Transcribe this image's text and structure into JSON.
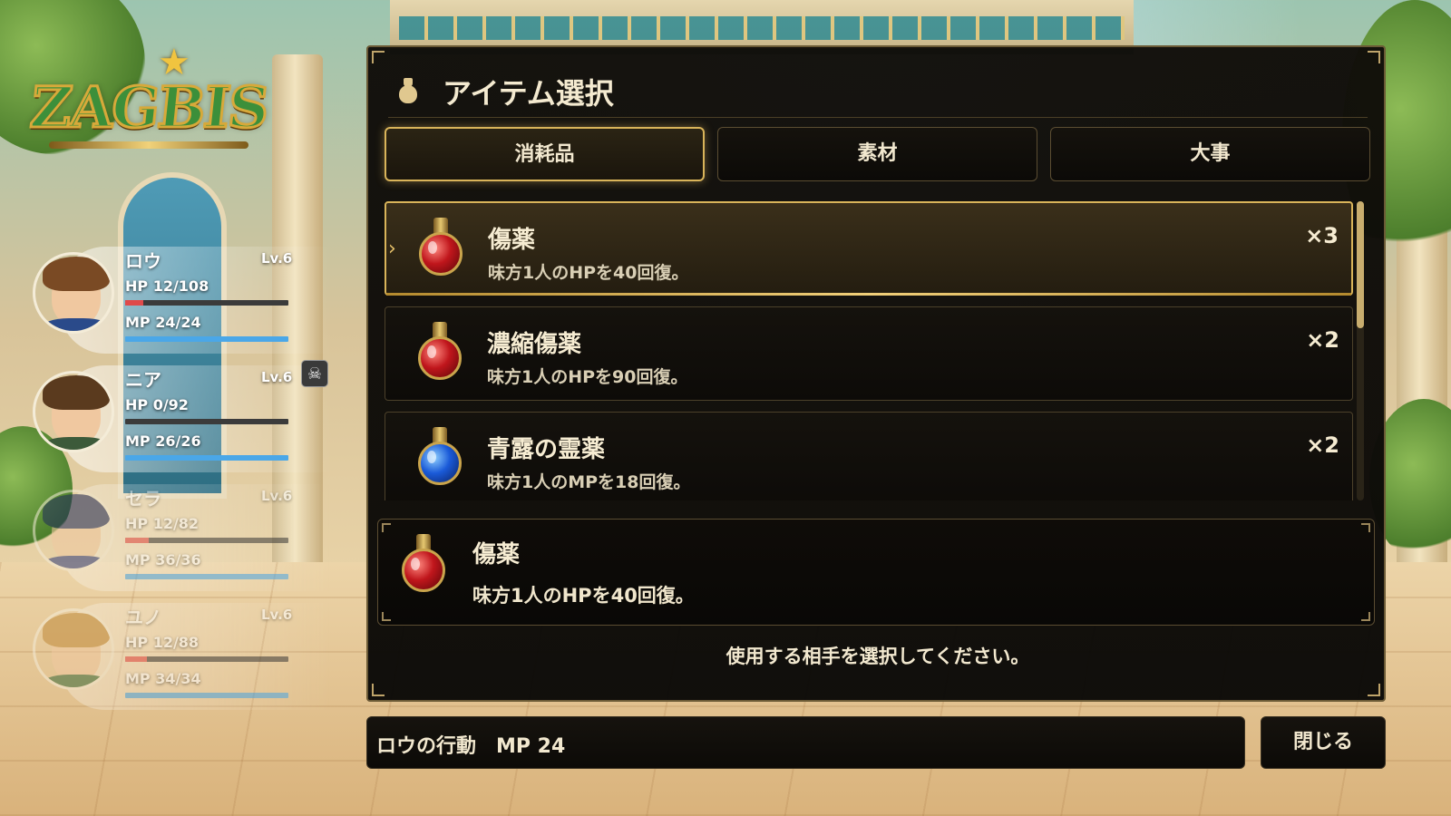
{
  "game": {
    "logo_text": "ZAGBIS"
  },
  "party": [
    {
      "name": "ロウ",
      "level": "Lv.6",
      "hp_text": "HP 12/108",
      "mp_text": "MP 24/24",
      "hp_ratio": 0.111,
      "mp_ratio": 1.0,
      "active": true,
      "status": null
    },
    {
      "name": "ニア",
      "level": "Lv.6",
      "hp_text": "HP 0/92",
      "mp_text": "MP 26/26",
      "hp_ratio": 0.0,
      "mp_ratio": 1.0,
      "active": true,
      "status": "skull-icon"
    },
    {
      "name": "セラ",
      "level": "Lv.6",
      "hp_text": "HP 12/82",
      "mp_text": "MP 36/36",
      "hp_ratio": 0.146,
      "mp_ratio": 1.0,
      "active": false,
      "status": null
    },
    {
      "name": "ユノ",
      "level": "Lv.6",
      "hp_text": "HP 12/88",
      "mp_text": "MP 34/34",
      "hp_ratio": 0.136,
      "mp_ratio": 1.0,
      "active": false,
      "status": null
    }
  ],
  "dialog": {
    "icon": "bag-icon",
    "title": "アイテム選択",
    "tabs": [
      {
        "label": "消耗品",
        "active": true
      },
      {
        "label": "素材",
        "active": false
      },
      {
        "label": "大事",
        "active": false
      }
    ],
    "items": [
      {
        "name": "傷薬",
        "description": "味方1人のHPを40回復。",
        "quantity": "×3",
        "icon": "red-potion-icon",
        "selected": true
      },
      {
        "name": "濃縮傷薬",
        "description": "味方1人のHPを90回復。",
        "quantity": "×2",
        "icon": "red-potion-icon",
        "selected": false
      },
      {
        "name": "青露の霊薬",
        "description": "味方1人のMPを18回復。",
        "quantity": "×2",
        "icon": "blue-potion-icon",
        "selected": false
      }
    ],
    "detail": {
      "name": "傷薬",
      "description": "味方1人のHPを40回復。",
      "icon": "red-potion-icon"
    },
    "prompt": "使用する相手を選択してください。"
  },
  "action_bar": {
    "text": "ロウの行動　MP 24",
    "close_label": "閉じる"
  },
  "colors": {
    "accent_gold": "#d9b45a",
    "hp_bar": "#e04a4a",
    "mp_bar": "#4aa7e8",
    "panel_bg": "#100d09"
  }
}
